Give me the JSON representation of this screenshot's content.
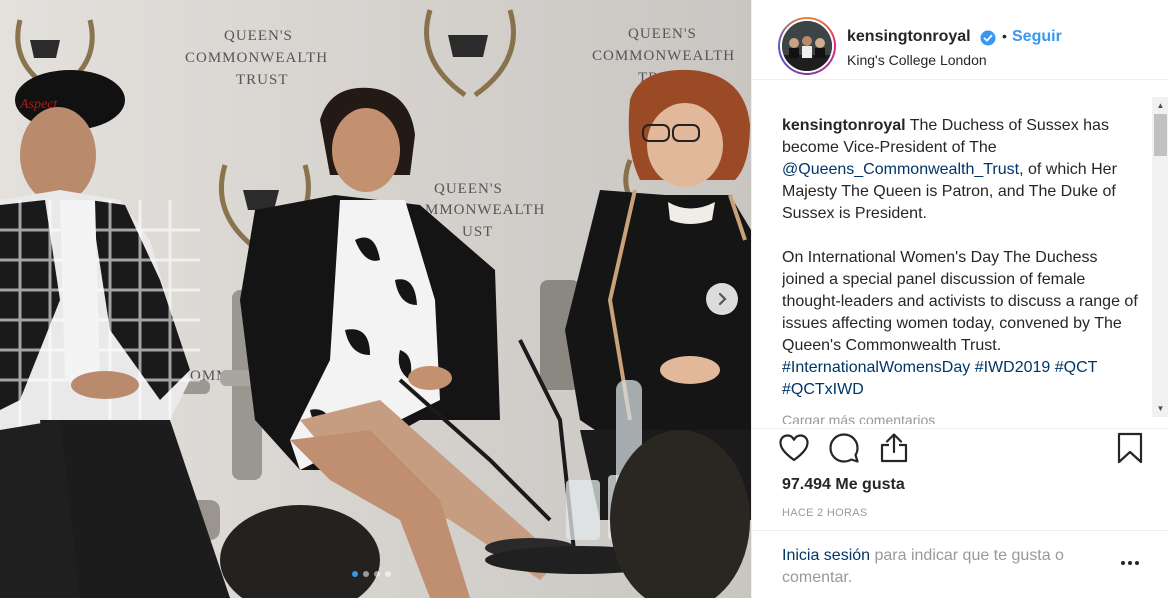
{
  "post": {
    "photo": {
      "backdrop_text": "QUEEN'S\nCOMMONWEALTH\nTRUST",
      "slides_count": 4,
      "active_slide": 1
    },
    "header": {
      "username": "kensingtonroyal",
      "separator": "•",
      "follow_label": "Seguir",
      "location": "King's College London"
    },
    "caption": {
      "username": "kensingtonroyal",
      "paragraph1_a": " The Duchess of Sussex has become Vice-President of The ",
      "mention": "@Queens_Commonwealth_Trust",
      "paragraph1_b": ", of which Her Majesty The Queen is Patron, and The Duke of Sussex is President.",
      "paragraph2": "On International Women's Day The Duchess joined a special panel discussion of female thought-leaders and activists to discuss a range of issues affecting women today, convened by The Queen's Commonwealth Trust. ",
      "hashtags": [
        "#InternationalWomensDay",
        "#IWD2019",
        "#QCT",
        "#QCTxIWD"
      ],
      "more_comments": "Cargar más comentarios"
    },
    "likes": "97.494 Me gusta",
    "time": "HACE 2 HORAS",
    "login": {
      "link": "Inicia sesión",
      "rest": " para indicar que te gusta o comentar."
    }
  },
  "colors": {
    "accent": "#3897f0",
    "link": "#003569",
    "muted": "#999999"
  },
  "icons": [
    "next-arrow-icon",
    "verified-badge-icon",
    "heart-icon",
    "comment-icon",
    "share-icon",
    "bookmark-icon",
    "more-options-icon"
  ]
}
